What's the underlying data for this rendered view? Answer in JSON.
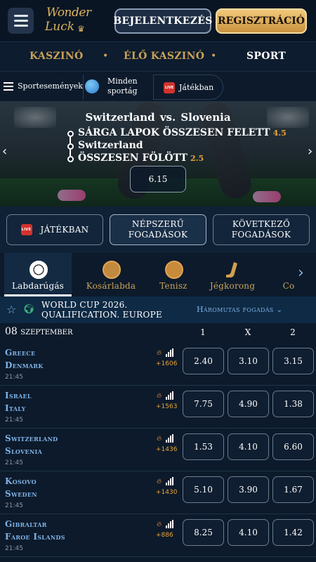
{
  "header": {
    "logo_line1": "Wonder",
    "logo_line2": "Luck",
    "login_label": "BEJELENTKEZÉS",
    "register_label": "REGISZTRÁCIÓ"
  },
  "topnav": {
    "items": [
      "KASZINÓ",
      "ÉLŐ KASZINÓ",
      "SPORT"
    ],
    "active": "SPORT"
  },
  "subnav": {
    "sport_events": "Sportesemények",
    "all_sports_line1": "Minden",
    "all_sports_line2": "sportág",
    "live_badge": "LIVE",
    "live_label": "Játékban"
  },
  "banner": {
    "title": "Switzerland  vs.  Slovenia",
    "lines": [
      {
        "text": "Sárga lapok összesen felett",
        "odd": "4.5"
      },
      {
        "text": "Switzerland",
        "odd": ""
      },
      {
        "text": "Összesen fölött",
        "odd": "2.5"
      }
    ],
    "total_odd": "6.15"
  },
  "tabs": {
    "live": "JÁTÉKBAN",
    "popular_line1": "NÉPSZERŰ",
    "popular_line2": "FOGADÁSOK",
    "next_line1": "KÖVETKEZŐ",
    "next_line2": "FOGADÁSOK"
  },
  "sports": [
    {
      "label": "Labdarúgás",
      "icon": "soccer-ball-icon"
    },
    {
      "label": "Kosárlabda",
      "icon": "basketball-icon"
    },
    {
      "label": "Tenisz",
      "icon": "tennis-ball-icon"
    },
    {
      "label": "Jégkorong",
      "icon": "hockey-icon"
    },
    {
      "label": "Co",
      "icon": ""
    }
  ],
  "league": {
    "name_line1": "WORLD CUP 2026.",
    "name_line2": "QUALIFICATION. EUROPE",
    "market": "Háromutas fogadás"
  },
  "date_row": {
    "date": "08 szeptember",
    "col1": "1",
    "colx": "X",
    "col2": "2"
  },
  "matches": [
    {
      "home": "Greece",
      "away": "Denmark",
      "time": "21:45",
      "more": "+1606",
      "odds": [
        "2.40",
        "3.10",
        "3.15"
      ]
    },
    {
      "home": "Israel",
      "away": "Italy",
      "time": "21:45",
      "more": "+1563",
      "odds": [
        "7.75",
        "4.90",
        "1.38"
      ]
    },
    {
      "home": "Switzerland",
      "away": "Slovenia",
      "time": "21:45",
      "more": "+1436",
      "odds": [
        "1.53",
        "4.10",
        "6.60"
      ]
    },
    {
      "home": "Kosovo",
      "away": "Sweden",
      "time": "21:45",
      "more": "+1430",
      "odds": [
        "5.10",
        "3.90",
        "1.67"
      ]
    },
    {
      "home": "Gibraltar",
      "away": "Faroe Islands",
      "time": "21:45",
      "more": "+886",
      "odds": [
        "8.25",
        "4.10",
        "1.42"
      ]
    }
  ],
  "colors": {
    "gold": "#c9a257",
    "link_blue": "#7fb2e5",
    "background": "#0c1a2b",
    "orange_odd": "#e8a437"
  }
}
